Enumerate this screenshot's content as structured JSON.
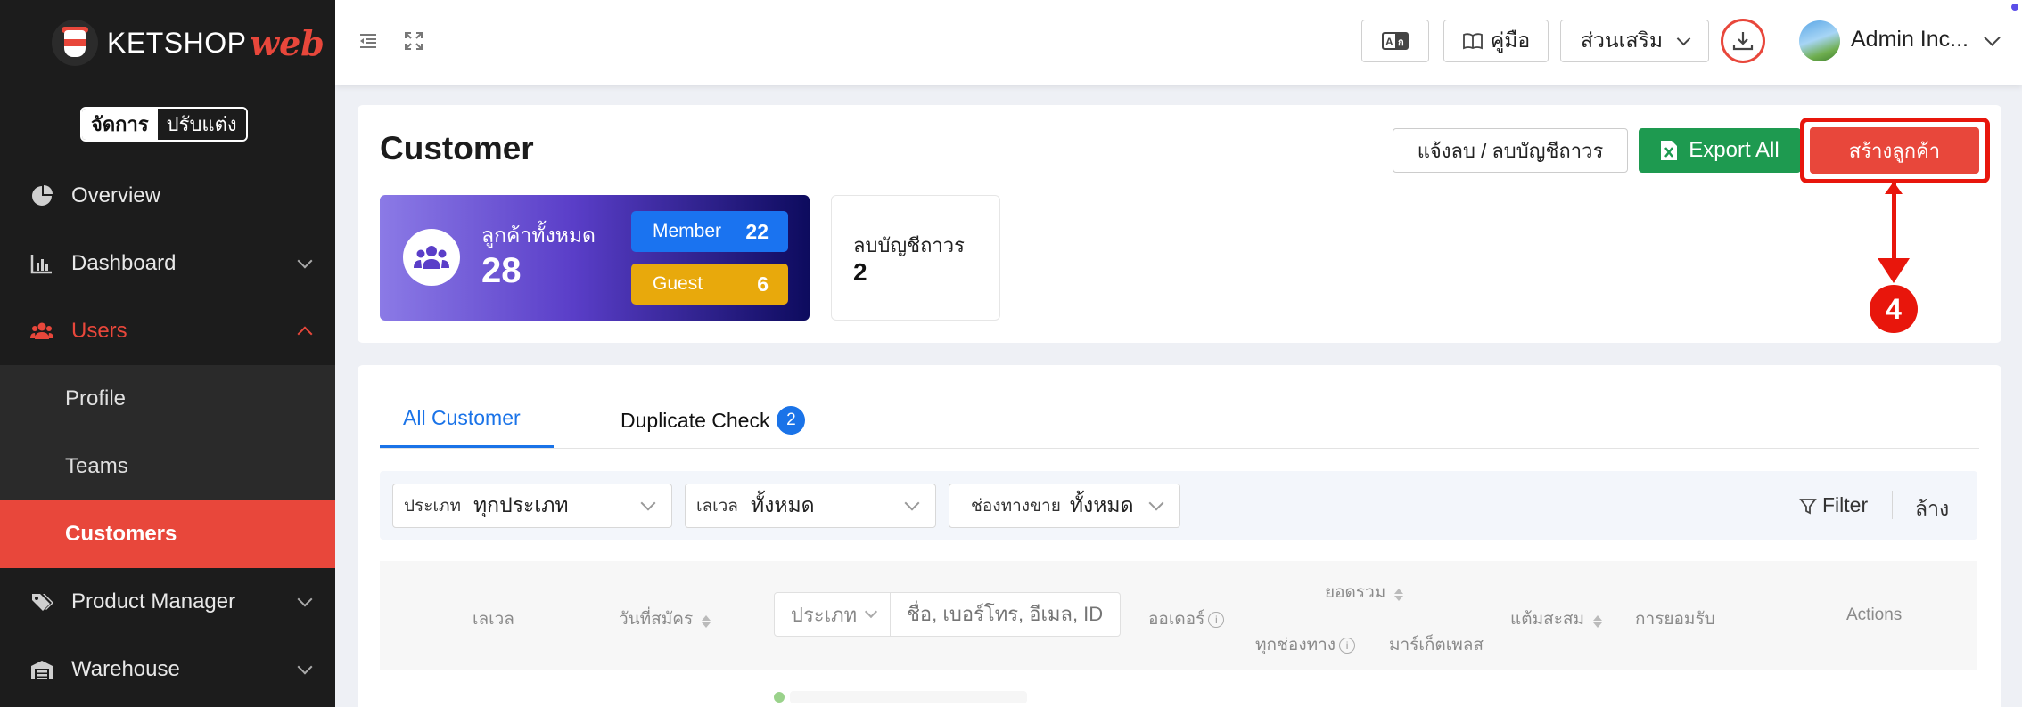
{
  "brand": {
    "name": "KETSHOP",
    "suffix": "web"
  },
  "mode_toggle": {
    "active": "จัดการ",
    "inactive": "ปรับแต่ง"
  },
  "sidebar": {
    "items": [
      {
        "label": "Overview",
        "icon": "pie-chart-icon"
      },
      {
        "label": "Dashboard",
        "icon": "bar-chart-icon"
      },
      {
        "label": "Users",
        "icon": "users-icon"
      },
      {
        "label": "Product Manager",
        "icon": "tags-icon"
      },
      {
        "label": "Warehouse",
        "icon": "warehouse-icon"
      }
    ],
    "sub_items": [
      {
        "label": "Profile"
      },
      {
        "label": "Teams"
      },
      {
        "label": "Customers"
      }
    ]
  },
  "topbar": {
    "guide_label": "คู่มือ",
    "addons_label": "ส่วนเสริม",
    "user_name": "Admin Inc..."
  },
  "header": {
    "title": "Customer",
    "report_button": "แจ้งลบ / ลบบัญชีถาวร",
    "export_button": "Export All",
    "create_button": "สร้างลูกค้า",
    "step_number": "4"
  },
  "stats": {
    "total_label": "ลูกค้าทั้งหมด",
    "total_value": "28",
    "member_label": "Member",
    "member_value": "22",
    "guest_label": "Guest",
    "guest_value": "6",
    "permanent_label": "ลบบัญชีถาวร",
    "permanent_value": "2"
  },
  "tabs": {
    "all_label": "All Customer",
    "dup_label": "Duplicate Check",
    "dup_count": "2"
  },
  "filters": {
    "type_key": "ประเภท",
    "type_value": "ทุกประเภท",
    "level_key": "เลเวล",
    "level_value": "ทั้งหมด",
    "channel_key": "ช่องทางขาย",
    "channel_value": "ทั้งหมด",
    "filter_label": "Filter",
    "clear_label": "ล้าง"
  },
  "table": {
    "level": "เลเวล",
    "register_date": "วันที่สมัคร",
    "type_select": "ประเภท",
    "search_placeholder": "ชื่อ, เบอร์โทร, อีเมล, ID",
    "order": "ออเดอร์",
    "total": "ยอดรวม",
    "all_channels": "ทุกช่องทาง",
    "marketplace": "มาร์เก็ตเพลส",
    "points": "แต้มสะสม",
    "approval": "การยอมรับ",
    "actions": "Actions"
  },
  "colors": {
    "accent": "#e8473b",
    "sidebar_bg": "#1c1c1c",
    "export_green": "#1e9a50",
    "tab_blue": "#1a73e8",
    "member_blue": "#1a73f0",
    "guest_yellow": "#e8a90c",
    "annotation_red": "#e8160c"
  }
}
